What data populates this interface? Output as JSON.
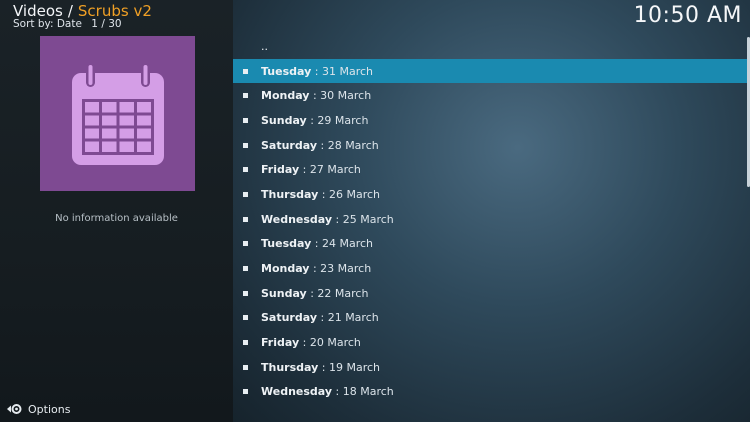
{
  "header": {
    "root": "Videos",
    "separator": "/",
    "current": "Scrubs v2",
    "sort_label": "Sort by: Date",
    "position": "1 / 30"
  },
  "clock": "10:50 AM",
  "info": {
    "thumbnail_icon": "calendar-icon",
    "no_info": "No information available"
  },
  "footer": {
    "options_label": "Options",
    "options_icon": "gear-back-icon"
  },
  "list": {
    "parent": "..",
    "items": [
      {
        "day": "Tuesday",
        "date": " : 31 March"
      },
      {
        "day": "Monday",
        "date": " : 30 March"
      },
      {
        "day": "Sunday",
        "date": " : 29 March"
      },
      {
        "day": "Saturday",
        "date": " : 28 March"
      },
      {
        "day": "Friday",
        "date": " : 27 March"
      },
      {
        "day": "Thursday",
        "date": " : 26 March"
      },
      {
        "day": "Wednesday",
        "date": " : 25 March"
      },
      {
        "day": "Tuesday",
        "date": " : 24 March"
      },
      {
        "day": "Monday",
        "date": " : 23 March"
      },
      {
        "day": "Sunday",
        "date": " : 22 March"
      },
      {
        "day": "Saturday",
        "date": " : 21 March"
      },
      {
        "day": "Friday",
        "date": " : 20 March"
      },
      {
        "day": "Thursday",
        "date": " : 19 March"
      },
      {
        "day": "Wednesday",
        "date": " : 18 March"
      }
    ],
    "focused_index": 0
  },
  "colors": {
    "accent": "#f0a025",
    "focus": "#1a8ab0",
    "thumbnail_bg": "#7e4a92",
    "calendar_fill": "#d49ee6"
  }
}
